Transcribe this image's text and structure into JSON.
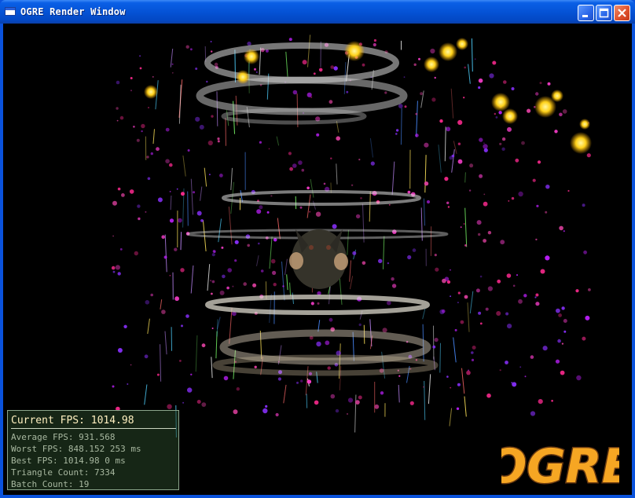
{
  "window": {
    "title": "OGRE Render Window",
    "controls": {
      "minimize": "minimize",
      "maximize": "maximize",
      "close": "close"
    }
  },
  "colors": {
    "titlebar": "#0553d6",
    "close_button": "#e0522c",
    "stats_text_current": "#fff0c0",
    "stats_text": "#a8b8a0",
    "logo_fill": "#f6a623"
  },
  "stats": {
    "current_fps": "Current FPS: 1014.98",
    "average_fps": "Average FPS: 931.568",
    "worst_fps": "Worst FPS: 848.152 253 ms",
    "best_fps": "Best FPS: 1014.98 0 ms",
    "triangle_count": "Triangle Count: 7334",
    "batch_count": "Batch Count: 19"
  },
  "logo": {
    "text": "OGRE"
  },
  "icons": [
    "window-app-icon",
    "minimize-icon",
    "maximize-icon",
    "close-icon"
  ]
}
